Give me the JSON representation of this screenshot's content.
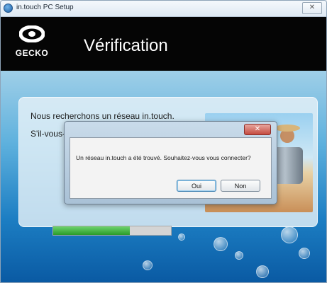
{
  "window": {
    "title": "in.touch PC Setup",
    "close_glyph": "✕"
  },
  "header": {
    "logo_text": "GECKO",
    "title": "Vérification"
  },
  "panel": {
    "line1": "Nous recherchons un réseau in.touch.",
    "line2": "S'il-vous-",
    "progress": 0.65
  },
  "dialog": {
    "close_glyph": "✕",
    "message": "Un réseau in.touch a été trouvé. Souhaitez-vous vous connecter?",
    "yes_label": "Oui",
    "no_label": "Non"
  },
  "colors": {
    "header_bg": "#050505",
    "progress_fill": "#2a9c2a",
    "accent": "#1c7ec3"
  }
}
